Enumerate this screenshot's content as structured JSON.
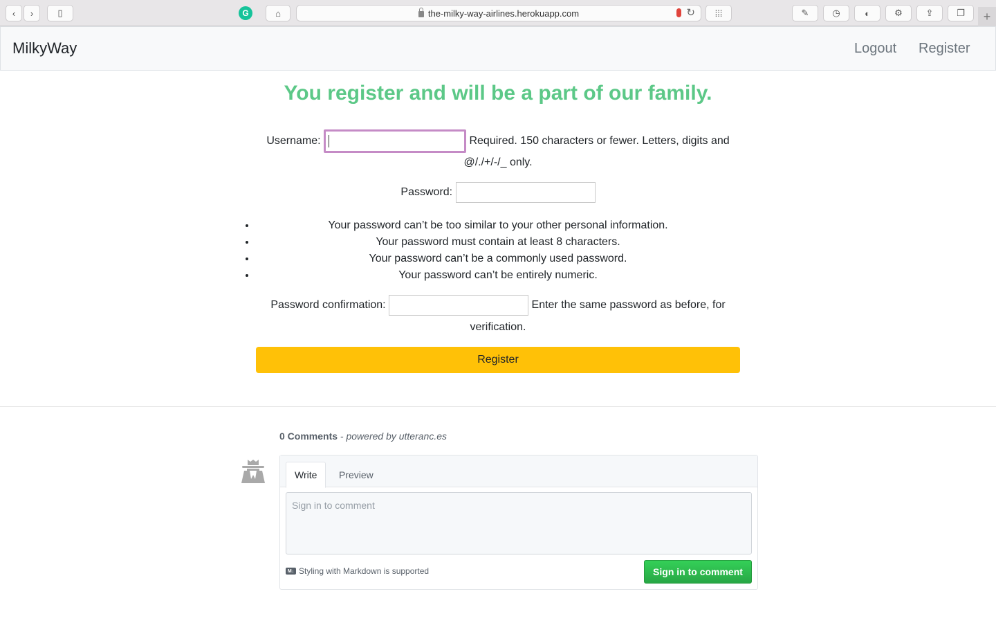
{
  "browser": {
    "url": "the-milky-way-airlines.herokuapp.com"
  },
  "navbar": {
    "brand": "MilkyWay",
    "links": [
      "Logout",
      "Register"
    ]
  },
  "form": {
    "heading": "You register and will be a part of our family.",
    "username_label": "Username:",
    "username_help_1": "Required. 150 characters or fewer. Letters, digits and",
    "username_help_2": "@/./+/-/_ only.",
    "password_label": "Password:",
    "password_rules": [
      "Your password can’t be too similar to your other personal information.",
      "Your password must contain at least 8 characters.",
      "Your password can’t be a commonly used password.",
      "Your password can’t be entirely numeric."
    ],
    "confirm_label": "Password confirmation:",
    "confirm_help_1": "Enter the same password as before, for",
    "confirm_help_2": "verification.",
    "submit_label": "Register"
  },
  "comments": {
    "count_label": "0 Comments",
    "powered_by": " - powered by utteranc.es",
    "tabs": [
      "Write",
      "Preview"
    ],
    "placeholder": "Sign in to comment",
    "markdown_note": "Styling with Markdown is supported",
    "signin_label": "Sign in to comment"
  },
  "colors": {
    "heading": "#5cc887",
    "register_button": "#ffc107",
    "signin_button": "#2ebc4f",
    "focus_ring": "#c58bc6"
  }
}
